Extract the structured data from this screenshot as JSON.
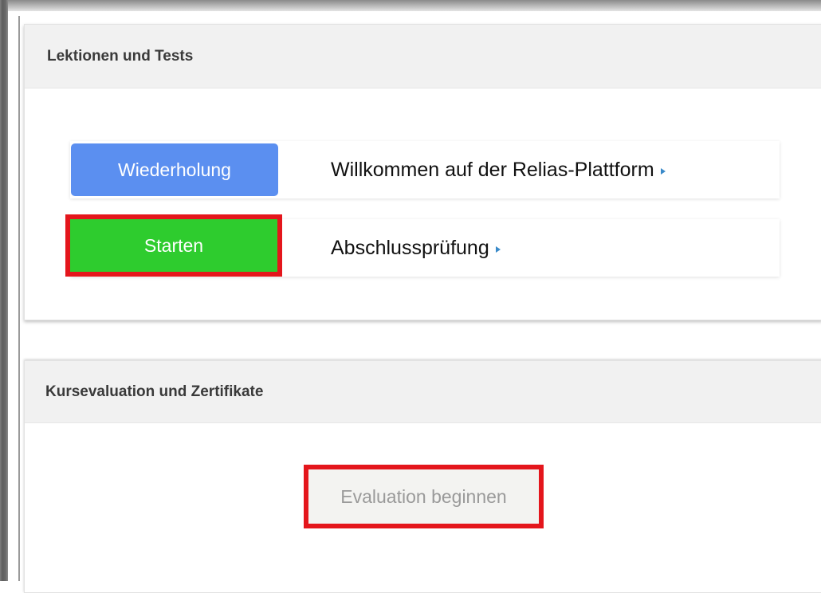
{
  "lessons_panel": {
    "title": "Lektionen und Tests",
    "rows": [
      {
        "button_label": "Wiederholung",
        "link_text": "Willkommen auf der Relias-Plattform"
      },
      {
        "button_label": "Starten",
        "link_text": "Abschlussprüfung"
      }
    ]
  },
  "evaluation_panel": {
    "title": "Kursevaluation und Zertifikate",
    "button_label": "Evaluation beginnen"
  },
  "colors": {
    "review_button": "#5b8ff0",
    "start_button": "#2ecc2e",
    "highlight_box": "#e4161c",
    "disabled_button": "#f3f3f1",
    "arrow": "#3a8ac9"
  },
  "icons": {
    "row_link_arrow": "arrow-right-icon"
  }
}
